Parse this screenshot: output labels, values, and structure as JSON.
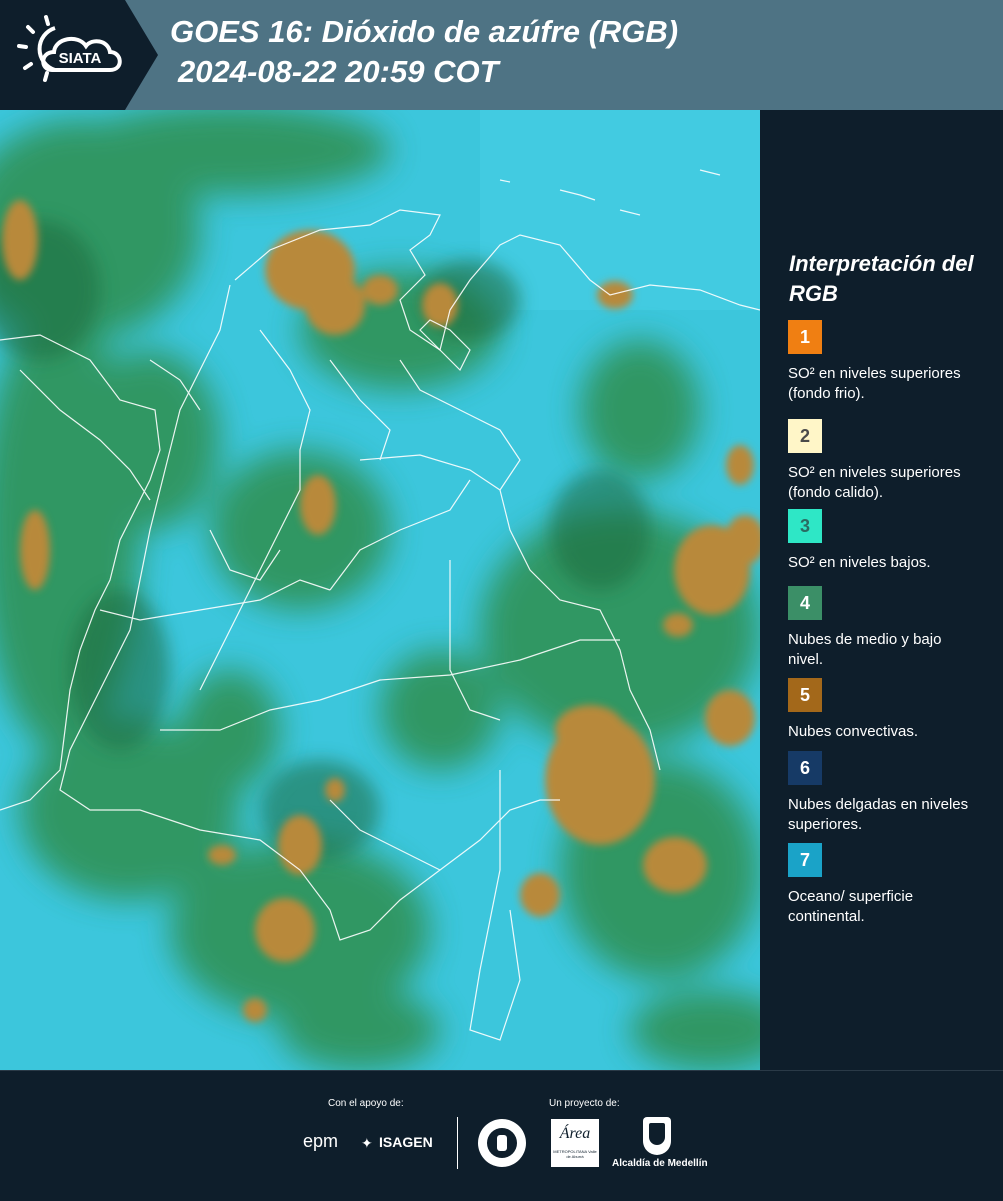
{
  "header": {
    "logo_text": "SIATA",
    "title_line1": "GOES 16: Dióxido de azúfre (RGB)",
    "title_line2": "2024-08-22 20:59 COT"
  },
  "legend": {
    "title": "Interpretación del RGB",
    "items": [
      {
        "number": "1",
        "color": "#f07f12",
        "text_color": "#ffffff",
        "label": "SO² en niveles superiores (fondo frio)."
      },
      {
        "number": "2",
        "color": "#fff6c8",
        "text_color": "#4a4a4a",
        "label": "SO² en niveles superiores (fondo calido)."
      },
      {
        "number": "3",
        "color": "#2ee7c6",
        "text_color": "#2a6c62",
        "label": "SO² en niveles bajos."
      },
      {
        "number": "4",
        "color": "#3b8f67",
        "text_color": "#ffffff",
        "label": "Nubes de medio y bajo nivel."
      },
      {
        "number": "5",
        "color": "#a3681a",
        "text_color": "#ffffff",
        "label": "Nubes convectivas."
      },
      {
        "number": "6",
        "color": "#163a66",
        "text_color": "#ffffff",
        "label": "Nubes delgadas en niveles superiores."
      },
      {
        "number": "7",
        "color": "#1aa3c8",
        "text_color": "#ffffff",
        "label": "Oceano/ superficie continental."
      }
    ]
  },
  "footer": {
    "support_label": "Con el apoyo de:",
    "project_label": "Un proyecto de:",
    "sponsor_1": "epm",
    "sponsor_2": "ISAGEN",
    "sponsor_3": "Área",
    "sponsor_3_sub": "METROPOLITANA Valle de Aburrá",
    "sponsor_4": "Alcaldía de Medellín"
  },
  "colors": {
    "header_bg": "#4e7384",
    "logo_bg": "#0e1e2b",
    "map_background": "#3cc6dc",
    "cloud_green": "#2f8f4f",
    "cloud_brown": "#b8893a",
    "borders": "#ffffff"
  }
}
